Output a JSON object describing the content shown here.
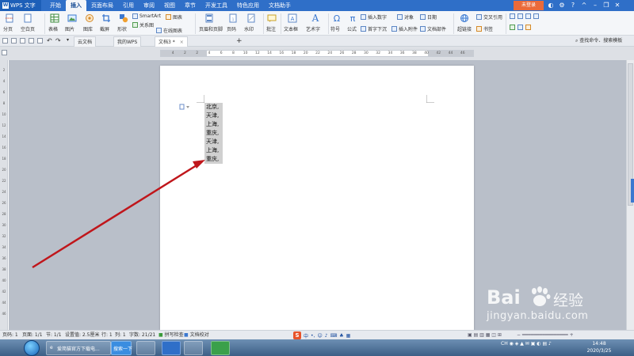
{
  "title_bar": {
    "app_name": "WPS 文字",
    "menu_tabs": [
      "开始",
      "插入",
      "页面布局",
      "引用",
      "审阅",
      "视图",
      "章节",
      "开发工具",
      "特色应用",
      "文档助手"
    ],
    "active_tab": "插入",
    "login_button": "未登录"
  },
  "ribbon": {
    "buttons": [
      "分页",
      "空白页",
      "表格",
      "图片",
      "图库",
      "截屏",
      "形状",
      "SmartArt",
      "图表",
      "关系图",
      "在线图表",
      "页眉和页脚",
      "页码",
      "水印",
      "批注",
      "文本框",
      "艺术字",
      "符号",
      "公式",
      "插入数字",
      "对象",
      "日期",
      "首字下沉",
      "插入附件",
      "文档部件",
      "超链接",
      "交叉引用",
      "书签"
    ]
  },
  "doc_tabs": {
    "tabs": [
      {
        "label": "云文档"
      },
      {
        "label": "我的WPS"
      },
      {
        "label": "文档3 *"
      }
    ],
    "new_tab": "+",
    "find_command": "查找命令、搜索模板"
  },
  "ruler": {
    "h_ticks": [
      "4",
      "2",
      "2",
      "4",
      "6",
      "8",
      "10",
      "12",
      "14",
      "16",
      "18",
      "20",
      "22",
      "24",
      "26",
      "28",
      "30",
      "32",
      "34",
      "36",
      "38",
      "40",
      "42",
      "44",
      "46"
    ],
    "v_ticks": [
      "2",
      "4",
      "6",
      "8",
      "10",
      "12",
      "14",
      "16",
      "18",
      "20",
      "22",
      "24",
      "26",
      "28",
      "30",
      "32",
      "34",
      "36",
      "38",
      "40",
      "42",
      "44",
      "46"
    ]
  },
  "document": {
    "lines": [
      "北京,",
      "天津,",
      "上海,",
      "重庆,",
      "天津,",
      "上海,",
      "重庆,"
    ]
  },
  "status_bar": {
    "page_no": "页码: 1",
    "pages": "页面: 1/1",
    "section": "节: 1/1",
    "setting": "设置值: 2.5厘米",
    "row": "行: 1",
    "col": "列: 1",
    "word_count": "字数: 21/21",
    "spell_check": "拼写检查",
    "doc_proof": "文档校对",
    "ime": "中"
  },
  "taskbar": {
    "task_label": "爱简猫官方下载电...",
    "search_label": "搜索一下",
    "tray_lang": "CH",
    "clock_time": "14:48",
    "clock_date": "2020/3/25"
  },
  "watermark": {
    "brand": "Bai",
    "brand_cn": "经验",
    "url": "jingyan.baidu.com"
  },
  "colors": {
    "title_bar": "#2f6fc8",
    "annotation_arrow": "#c0161b",
    "selection": "#d0d0d0"
  }
}
